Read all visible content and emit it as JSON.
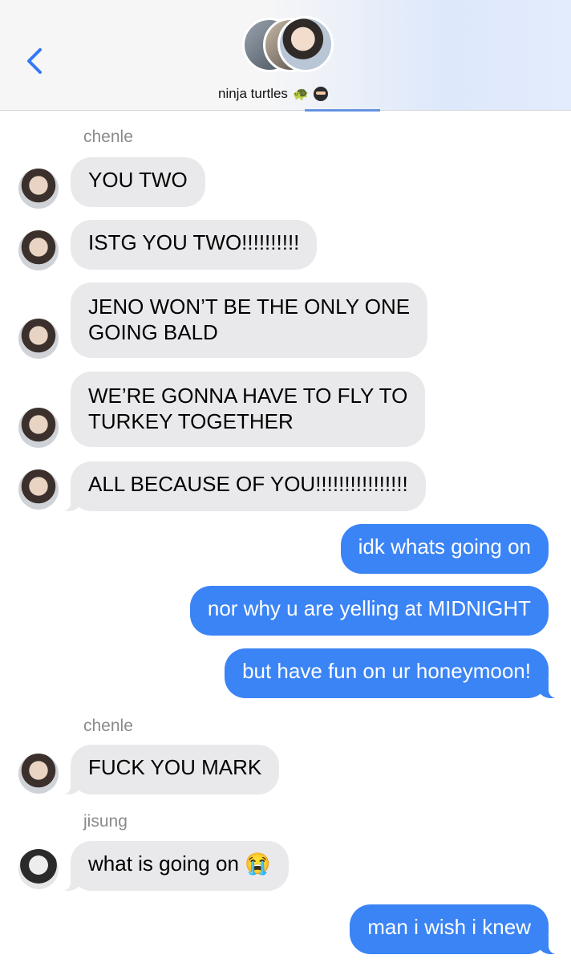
{
  "header": {
    "group_name": "ninja turtles",
    "icons": [
      "turtle-emoji",
      "ninja-emoji",
      "back-chevron-icon"
    ],
    "turtle_glyph": "🐢"
  },
  "colors": {
    "incoming_bubble": "#e9e9eb",
    "outgoing_bubble": "#3b84f5",
    "sender_label": "#8a8a8e",
    "header_bg": "#f6f6f7",
    "back_chevron": "#3478f6"
  },
  "messages": [
    {
      "type": "sender",
      "text": "chenle"
    },
    {
      "type": "in",
      "sender": "chenle",
      "text": "YOU TWO"
    },
    {
      "type": "in",
      "sender": "chenle",
      "text": "ISTG YOU TWO!!!!!!!!!!"
    },
    {
      "type": "in",
      "sender": "chenle",
      "lines": [
        "JENO WON’T BE THE ONLY ONE",
        "GOING BALD"
      ]
    },
    {
      "type": "in",
      "sender": "chenle",
      "lines": [
        "WE’RE GONNA HAVE TO FLY TO",
        "TURKEY TOGETHER"
      ]
    },
    {
      "type": "in",
      "sender": "chenle",
      "text": "ALL BECAUSE OF YOU!!!!!!!!!!!!!!!!"
    },
    {
      "type": "out",
      "text": "idk whats going on"
    },
    {
      "type": "out",
      "text": "nor why u are yelling at MIDNIGHT"
    },
    {
      "type": "out",
      "text": "but have fun on ur honeymoon!"
    },
    {
      "type": "sender",
      "text": "chenle"
    },
    {
      "type": "in",
      "sender": "chenle",
      "text": "FUCK YOU MARK"
    },
    {
      "type": "sender",
      "text": "jisung"
    },
    {
      "type": "in",
      "sender": "jisung",
      "text": "what is going on",
      "emoji": "😭"
    },
    {
      "type": "out",
      "text": "man i wish i knew"
    }
  ]
}
